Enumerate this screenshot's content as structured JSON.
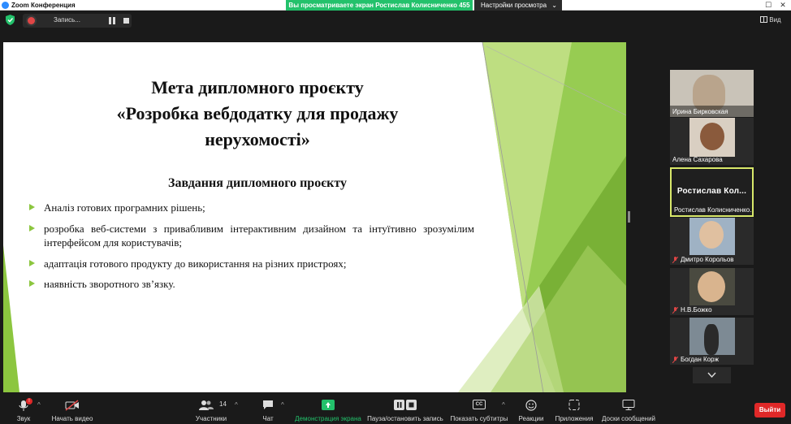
{
  "window": {
    "title": "Zoom Конференция"
  },
  "banner": {
    "share_text": "Вы просматриваете экран Ростислав Колисниченко 455",
    "view_settings": "Настройки просмотра"
  },
  "recording": {
    "label": "Запись..."
  },
  "view_button": {
    "label": "Вид"
  },
  "slide": {
    "title": "Мета дипломного проєкту\n«Розробка вебдодатку для продажу\nнерухомості»",
    "subtitle": "Завдання дипломного проєкту",
    "bullets": [
      "Аналіз готових програмних рішень;",
      "розробка веб-системи з привабливим інтерактивним дизайном та  інтуїтивно зрозумілим інтерфейсом для користувачів;",
      "адаптація готового продукту до використання на різних пристроях;",
      "наявність зворотного зв’язку."
    ],
    "accent_color": "#8cc63f"
  },
  "participants": [
    {
      "name": "Ирина Бирковская",
      "muted": false
    },
    {
      "name": "Алена Сахарова",
      "muted": false
    },
    {
      "name": "Ростислав Колисниченко...",
      "display": "Ростислав  Кол...",
      "muted": false,
      "active": true
    },
    {
      "name": "Дмитро Корольов",
      "muted": true
    },
    {
      "name": "Н.В.Божко",
      "muted": true
    },
    {
      "name": "Богдан Корж",
      "muted": true
    }
  ],
  "toolbar": {
    "audio": "Звук",
    "audio_badge": "!",
    "video": "Начать видео",
    "participants": "Участники",
    "participants_count": "14",
    "chat": "Чат",
    "share": "Демонстрация экрана",
    "pause_recording": "Пауза/остановить запись",
    "captions": "Показать субтитры",
    "captions_icon": "CC",
    "reactions": "Реакции",
    "apps": "Приложения",
    "whiteboards": "Доски сообщений",
    "leave": "Выйти"
  },
  "colors": {
    "share_banner": "#23c16b",
    "leave": "#e02828",
    "active_speaker_border": "#d8e86a"
  }
}
